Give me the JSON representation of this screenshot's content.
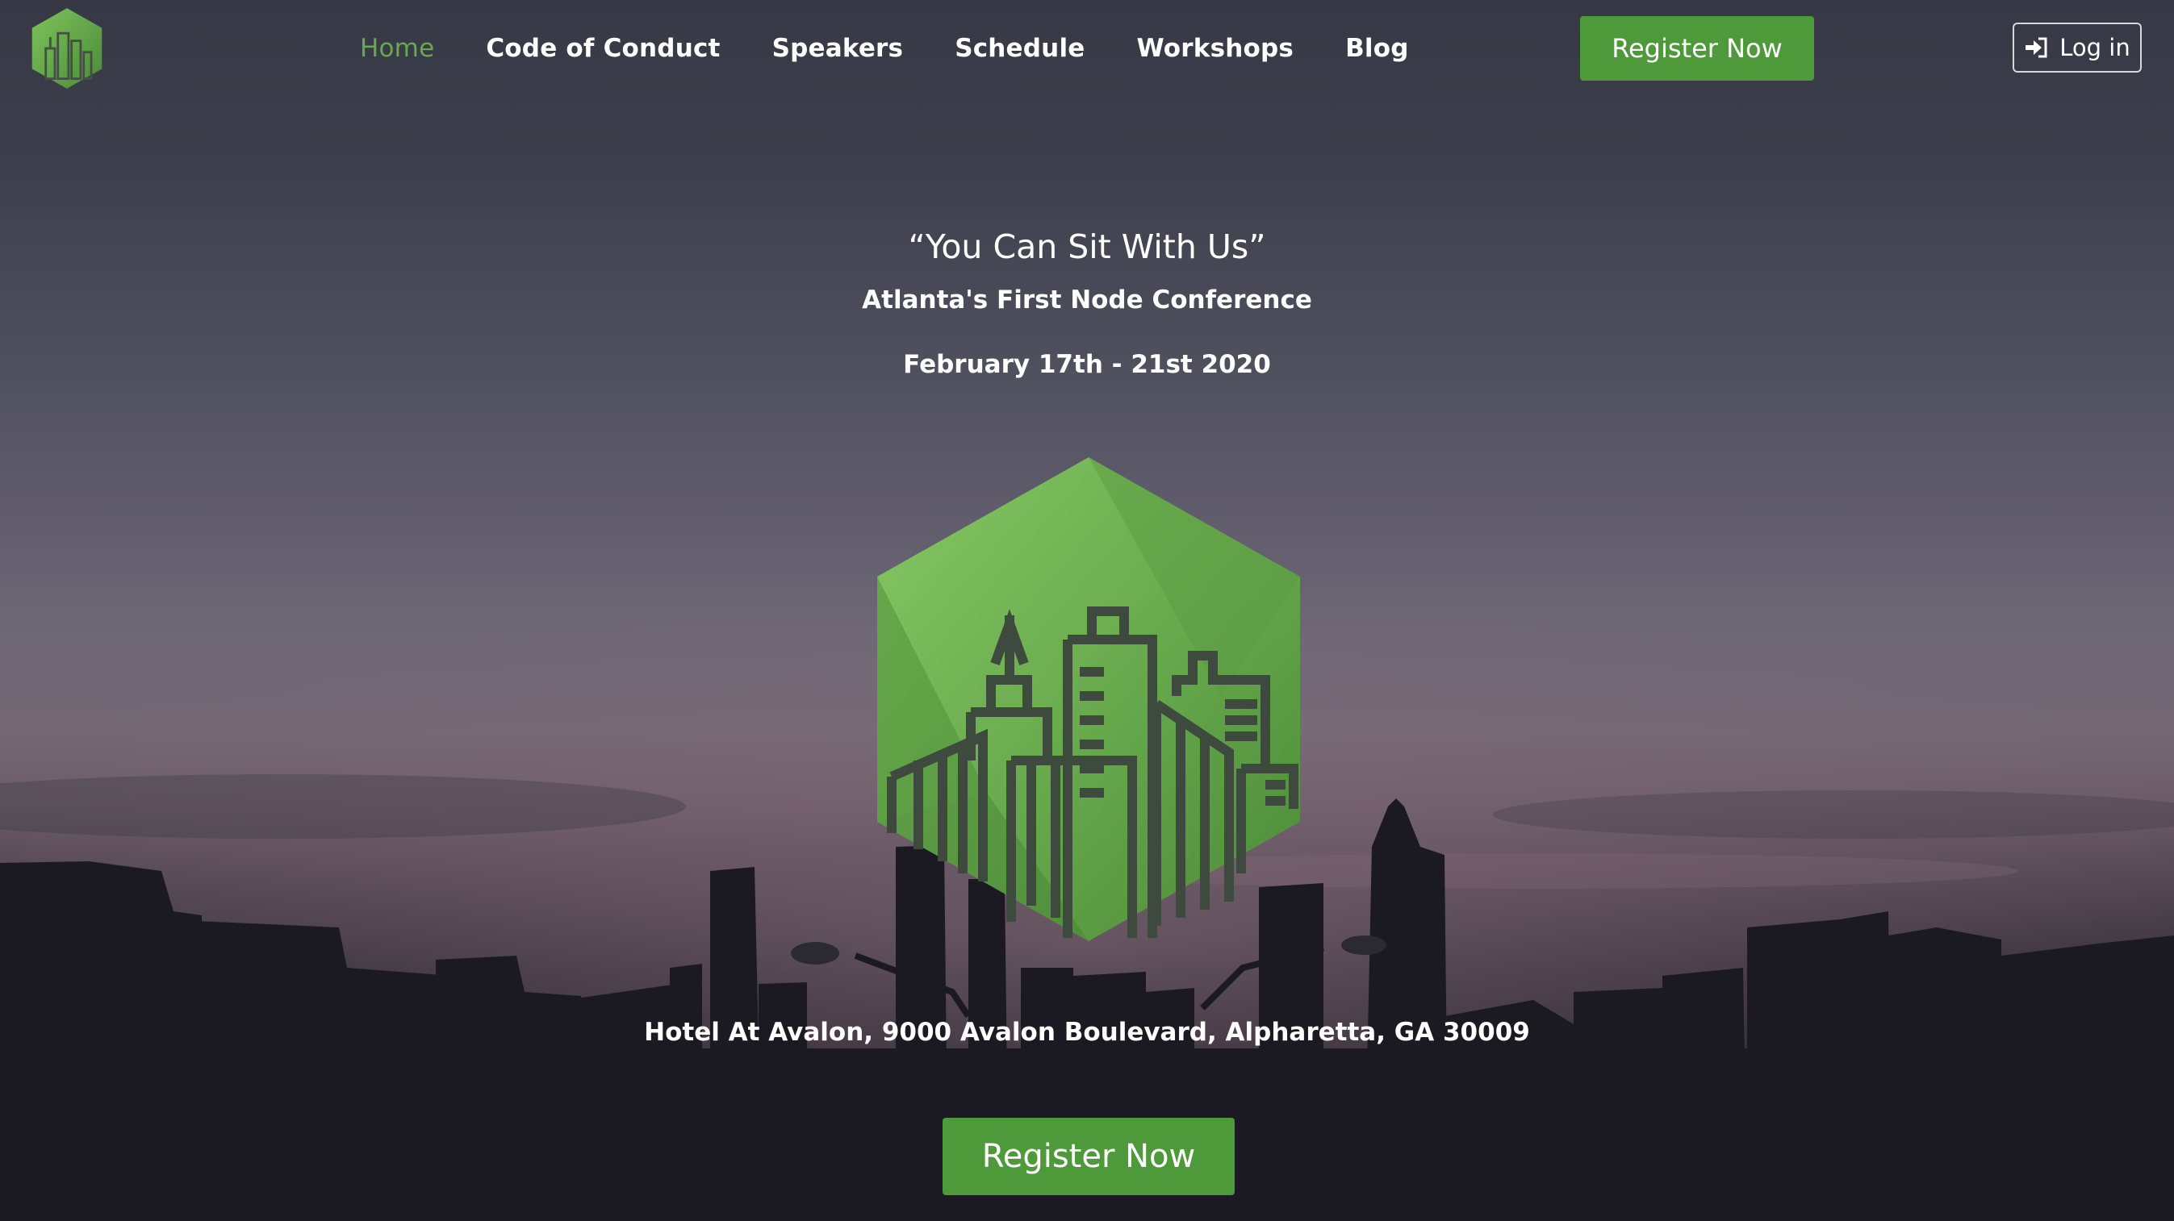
{
  "nav": {
    "links": [
      {
        "label": "Home",
        "active": true
      },
      {
        "label": "Code of Conduct",
        "active": false
      },
      {
        "label": "Speakers",
        "active": false
      },
      {
        "label": "Schedule",
        "active": false
      },
      {
        "label": "Workshops",
        "active": false
      },
      {
        "label": "Blog",
        "active": false
      }
    ],
    "register_label": "Register Now",
    "login_label": "Log in",
    "logo_icon": "city-hexagon-logo-icon",
    "login_icon": "sign-in-icon"
  },
  "hero": {
    "title": "“You Can Sit With Us”",
    "subtitle": "Atlanta's First Node Conference",
    "date": "February 17th - 21st 2020",
    "logo_icon": "city-hexagon-logo-icon",
    "address": "Hotel At Avalon, 9000 Avalon Boulevard, Alpharetta, GA 30009",
    "register_label": "Register Now"
  },
  "colors": {
    "accent": "#4e9a3a",
    "active_link": "#69a84f",
    "logo_green_light": "#7dc35b",
    "logo_green_dark": "#4f8f39",
    "skyline": "#1a1a22"
  }
}
